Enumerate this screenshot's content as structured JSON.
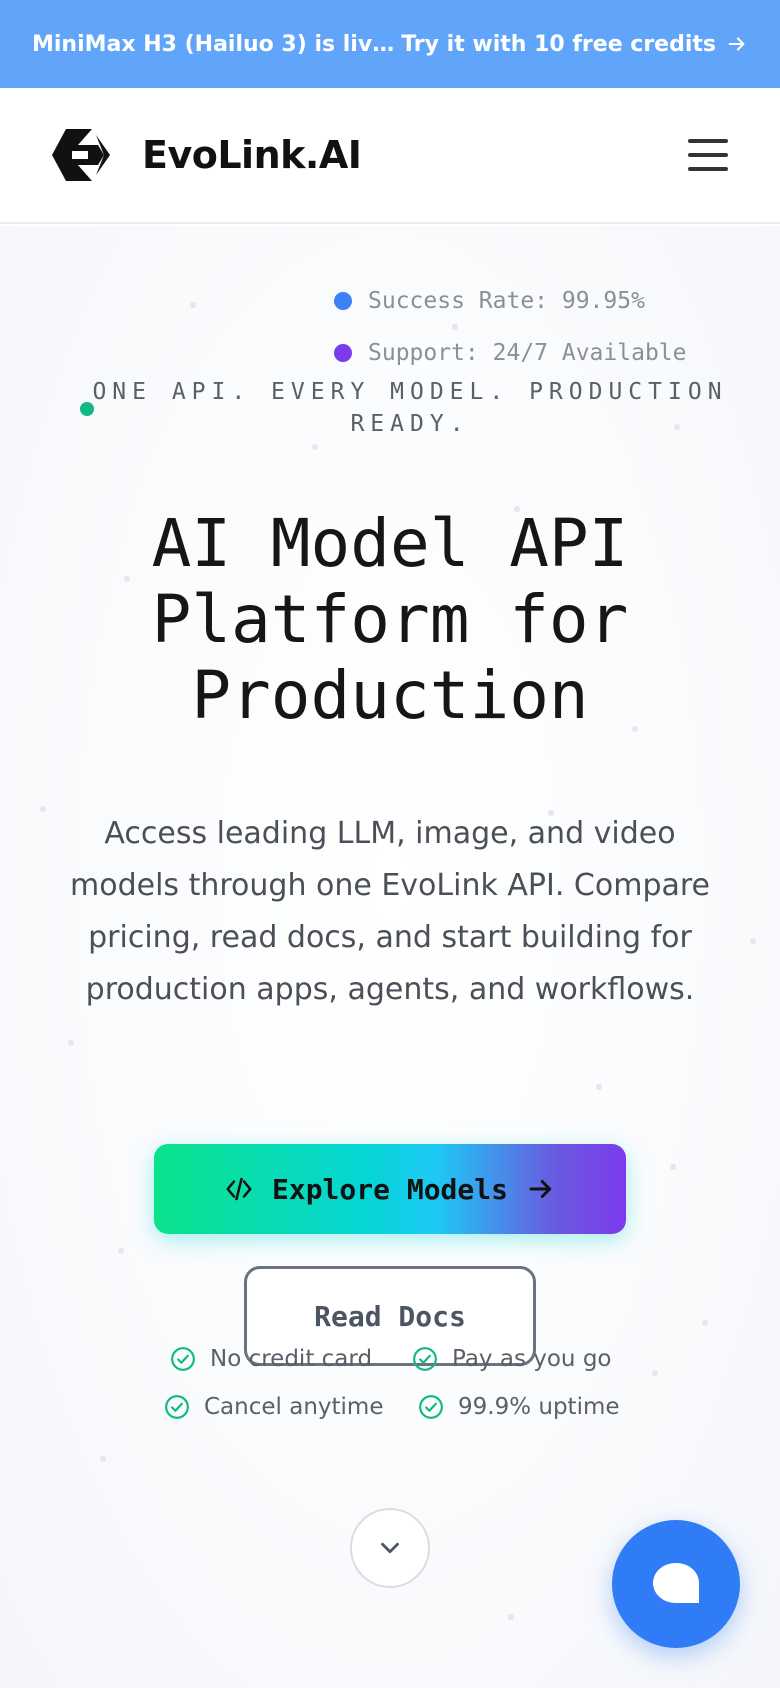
{
  "banner": {
    "text": "MiniMax H3 (Hailuo 3) is live o...",
    "cta": "Try it with 10 free credits",
    "cta_icon": "arrow-right-icon",
    "background": "#60a5fa"
  },
  "header": {
    "brand_name": "EvoLink.AI",
    "logo_icon": "evolink-logo",
    "menu_icon": "hamburger-menu-icon"
  },
  "hero": {
    "stats": [
      {
        "text": "Success Rate: 99.95%",
        "color": "#3b82f6"
      },
      {
        "text": "Support: 24/7 Available",
        "color": "#7c3aed"
      }
    ],
    "eyebrow": "ONE API. EVERY MODEL. PRODUCTION READY.",
    "title": "AI Model API Platform for Production",
    "description": "Access leading LLM, image, and video models through one EvoLink API. Compare pricing, read docs, and start building for production apps, agents, and workflows.",
    "primary_button": {
      "label": "Explore Models",
      "icon": "code-icon",
      "trailing_icon": "arrow-right-icon"
    },
    "secondary_button": {
      "label": "Read Docs"
    },
    "features": [
      "No credit card",
      "Pay as you go",
      "Cancel anytime",
      "99.9% uptime"
    ],
    "feature_icon": "check-circle-icon",
    "feature_color": "#10b981"
  },
  "floating": {
    "scroll_icon": "chevron-down-icon",
    "chat_icon": "chat-bubble-icon",
    "chat_color": "#2f7cf6"
  }
}
